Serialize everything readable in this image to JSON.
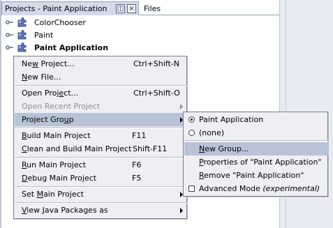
{
  "tabs": {
    "active_title": "Projects - Paint Application",
    "maximize_glyph": "◫",
    "close_glyph": "×",
    "other_tab": "Files"
  },
  "tree": [
    {
      "label": "ColorChooser",
      "bold": false,
      "icon": "project-puzzle-icon"
    },
    {
      "label": "Paint",
      "bold": false,
      "icon": "project-puzzle-icon"
    },
    {
      "label": "Paint Application",
      "bold": true,
      "icon": "main-project-puzzle-icon"
    }
  ],
  "menu": {
    "new_project": {
      "pre": "Ne",
      "u": "w",
      "post": " Project...",
      "acc": "Ctrl+Shift-N"
    },
    "new_file": {
      "pre": "",
      "u": "N",
      "post": "ew File..."
    },
    "open_project": {
      "pre": "Open Proj",
      "u": "e",
      "post": "ct...",
      "acc": "Ctrl+Shift-O"
    },
    "open_recent": {
      "label": "Open Recent Project"
    },
    "project_group": {
      "pre": "Project Gro",
      "u": "u",
      "post": "p"
    },
    "build_main": {
      "pre": "",
      "u": "B",
      "post": "uild Main Project",
      "acc": "F11"
    },
    "clean_build": {
      "pre": "",
      "u": "C",
      "post": "lean and Build Main Project",
      "acc": "Shift-F11"
    },
    "run_main": {
      "pre": "",
      "u": "R",
      "post": "un Main Project",
      "acc": "F6"
    },
    "debug_main": {
      "pre": "",
      "u": "D",
      "post": "ebug Main Project",
      "acc": "F5"
    },
    "set_main": {
      "pre": "Set ",
      "u": "M",
      "post": "ain Project"
    },
    "view_java": {
      "pre": "",
      "u": "V",
      "post": "iew Java Packages as"
    }
  },
  "submenu": {
    "paint_app": {
      "label": "Paint Application",
      "selected": true
    },
    "none": {
      "label": "(none)",
      "selected": false
    },
    "new_group": {
      "pre": "",
      "u": "N",
      "post": "ew Group..."
    },
    "properties": {
      "pre": "",
      "u": "P",
      "post": "roperties of \"Paint Application\""
    },
    "remove": {
      "pre": "",
      "u": "R",
      "post": "emove \"Paint Application\""
    },
    "advanced": {
      "label": "Advanced Mode",
      "note": "(experimental)",
      "checked": false
    }
  }
}
